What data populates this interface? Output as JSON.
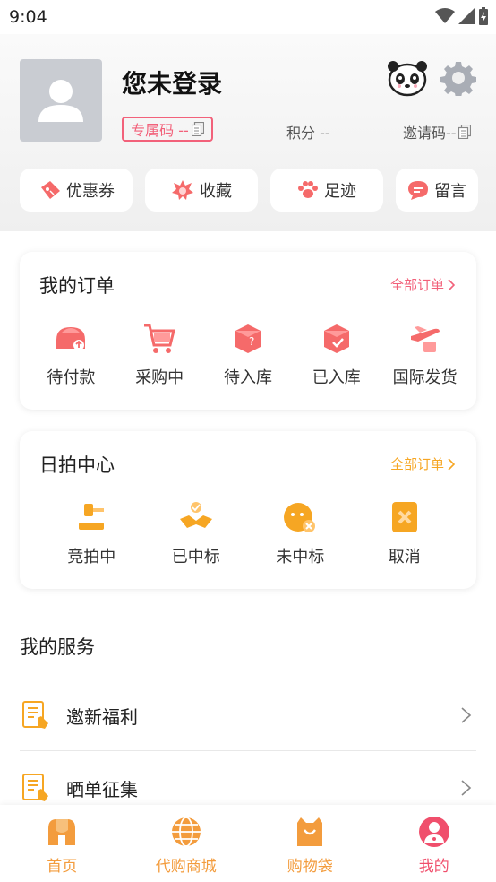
{
  "status_bar": {
    "time": "9:04"
  },
  "profile": {
    "login_status": "您未登录",
    "exclusive_code": "专属码 --",
    "points": "积分 --",
    "invite_code": "邀请码--"
  },
  "quick_actions": [
    {
      "label": "优惠券",
      "icon": "coupon-icon"
    },
    {
      "label": "收藏",
      "icon": "favorite-icon"
    },
    {
      "label": "足迹",
      "icon": "footprint-icon"
    },
    {
      "label": "留言",
      "icon": "message-icon"
    }
  ],
  "orders": {
    "title": "我的订单",
    "all_label": "全部订单",
    "items": [
      {
        "label": "待付款",
        "icon": "pending-payment-icon"
      },
      {
        "label": "采购中",
        "icon": "cart-icon"
      },
      {
        "label": "待入库",
        "icon": "box-pending-icon"
      },
      {
        "label": "已入库",
        "icon": "box-stored-icon"
      },
      {
        "label": "国际发货",
        "icon": "airplane-icon"
      }
    ]
  },
  "auction": {
    "title": "日拍中心",
    "all_label": "全部订单",
    "items": [
      {
        "label": "竞拍中",
        "icon": "gavel-icon"
      },
      {
        "label": "已中标",
        "icon": "handshake-icon"
      },
      {
        "label": "未中标",
        "icon": "failed-bid-icon"
      },
      {
        "label": "取消",
        "icon": "cancel-icon"
      }
    ]
  },
  "services": {
    "title": "我的服务",
    "items": [
      {
        "label": "邀新福利",
        "icon": "document-hand-icon"
      },
      {
        "label": "晒单征集",
        "icon": "document-hand-icon"
      }
    ]
  },
  "tabs": [
    {
      "label": "首页",
      "icon": "home-icon"
    },
    {
      "label": "代购商城",
      "icon": "globe-icon"
    },
    {
      "label": "购物袋",
      "icon": "shopping-bag-icon"
    },
    {
      "label": "我的",
      "icon": "profile-icon"
    }
  ],
  "colors": {
    "accent_pink": "#f2617a",
    "accent_orange": "#f6a623",
    "tab_orange": "#f39c3d",
    "tab_active": "#f04f6c"
  }
}
